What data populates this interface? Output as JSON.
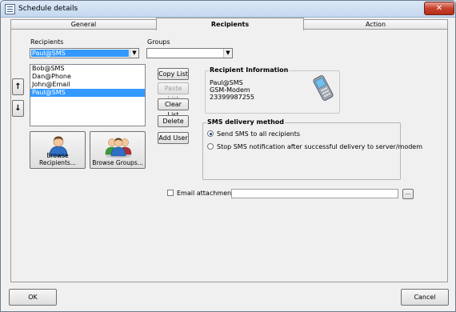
{
  "window": {
    "title": "Schedule details",
    "close_glyph": "✕"
  },
  "tabs": [
    {
      "label": "General"
    },
    {
      "label": "Recipients"
    },
    {
      "label": "Action"
    }
  ],
  "recipients_label": "Recipients",
  "recipients_combo_value": "Paul@SMS",
  "groups_label": "Groups",
  "groups_combo_value": "",
  "recipient_list": [
    {
      "label": "Bob@SMS"
    },
    {
      "label": "Dan@Phone"
    },
    {
      "label": "John@Email"
    },
    {
      "label": "Paul@SMS"
    }
  ],
  "move_up_glyph": "↑",
  "move_down_glyph": "↓",
  "list_buttons": {
    "copy": "Copy List",
    "paste": "Paste List",
    "clear": "Clear List",
    "delete": "Delete",
    "add_user": "Add User"
  },
  "browse_recipients": "Browse Recipients...",
  "browse_groups": "Browse Groups...",
  "recipient_info": {
    "title": "Recipient Information",
    "lines": [
      "Paul@SMS",
      "GSM-Modem",
      "23399987255"
    ]
  },
  "sms_delivery": {
    "title": "SMS delivery method",
    "option1": "Send SMS to all recipients",
    "option2": "Stop SMS notification after successful delivery to server/modem",
    "selected": 0
  },
  "email_attachment": {
    "label": "Email attachment",
    "checked": false,
    "value": "",
    "browse_label": "..."
  },
  "footer": {
    "ok": "OK",
    "cancel": "Cancel"
  },
  "colors": {
    "selection": "#3399ff",
    "close_button": "#c8402b"
  },
  "icons": [
    "app-icon",
    "close-icon",
    "phone-icon",
    "person-icon",
    "group-icon"
  ]
}
